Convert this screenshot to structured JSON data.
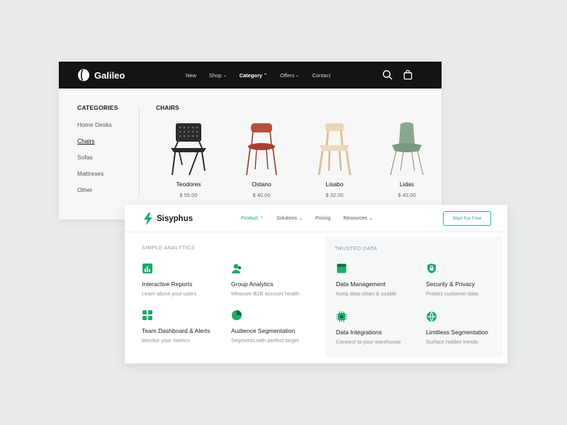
{
  "galileo": {
    "brand": "Galileo",
    "nav": [
      {
        "label": "New",
        "dropdown": false,
        "active": false
      },
      {
        "label": "Shop",
        "dropdown": true,
        "active": false
      },
      {
        "label": "Category",
        "dropdown": true,
        "active": true
      },
      {
        "label": "Offers",
        "dropdown": true,
        "active": false
      },
      {
        "label": "Contact",
        "dropdown": false,
        "active": false
      }
    ],
    "categories_heading": "CATEGORIES",
    "categories": [
      "Home Desks",
      "Chairs",
      "Sofas",
      "Mattreses",
      "Other"
    ],
    "active_category": "Chairs",
    "chairs_heading": "CHAIRS",
    "products": [
      {
        "name": "Teodores",
        "price": "$ 55.00",
        "color": "#2b2b2b"
      },
      {
        "name": "Ostano",
        "price": "$ 40.00",
        "color": "#b5523c"
      },
      {
        "name": "Lisabo",
        "price": "$ 32.00",
        "color": "#e8d2b0"
      },
      {
        "name": "Lidas",
        "price": "$ 45.00",
        "color": "#8aa88f"
      }
    ]
  },
  "sisyphus": {
    "brand": "Sisyphus",
    "accent": "#1faa6b",
    "nav": [
      {
        "label": "Product",
        "dropdown": true,
        "active": true
      },
      {
        "label": "Solutions",
        "dropdown": true,
        "active": false
      },
      {
        "label": "Pricing",
        "dropdown": false,
        "active": false
      },
      {
        "label": "Resources",
        "dropdown": true,
        "active": false
      }
    ],
    "cta": "Start For Free",
    "left_heading": "SIMPLE ANALYTICS",
    "right_heading": "TRUSTED DATA",
    "features": {
      "interactive_reports": {
        "title": "Interactive Reports",
        "desc": "Learn about your users",
        "icon": "bar-chart-icon"
      },
      "group_analytics": {
        "title": "Group Analytics",
        "desc": "Measure B2B account health",
        "icon": "users-icon"
      },
      "team_dashboard": {
        "title": "Team Dashboard & Alerts",
        "desc": "Monitor your metrics",
        "icon": "grid-icon"
      },
      "audience_segmentation": {
        "title": "Audience Segmentation",
        "desc": "Segments with perfect target",
        "icon": "pie-chart-icon"
      },
      "data_management": {
        "title": "Data Management",
        "desc": "Keep data clean & usable",
        "icon": "archive-icon"
      },
      "security_privacy": {
        "title": "Security & Privacy",
        "desc": "Protect customer data",
        "icon": "shield-icon"
      },
      "data_integrations": {
        "title": "Data Integrations",
        "desc": "Connect to your warehouse",
        "icon": "chip-icon"
      },
      "limitless_segmentation": {
        "title": "Limitless Segmentation",
        "desc": "Surface hidden trends",
        "icon": "globe-icon"
      }
    }
  }
}
